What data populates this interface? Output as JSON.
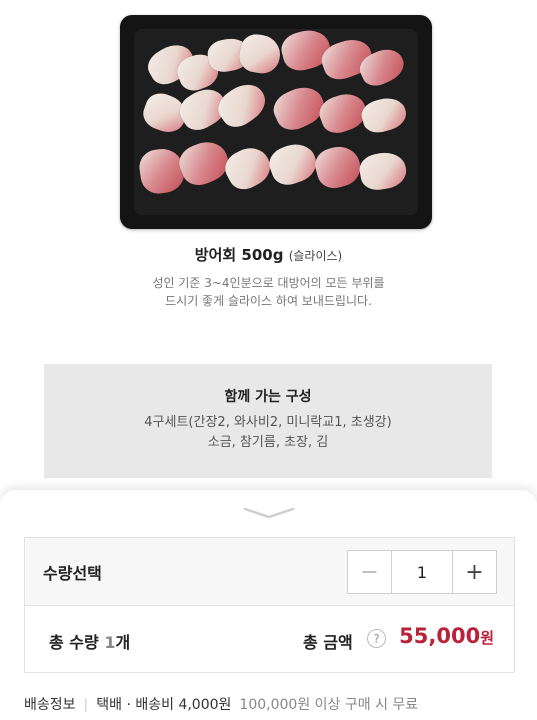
{
  "product": {
    "name": "방어회 500g",
    "name_suffix": "(슬라이스)",
    "desc_line1": "성인 기준 3~4인분으로 대방어의 모든 부위를",
    "desc_line2": "드시기 좋게 슬라이스 하여 보내드립니다."
  },
  "composition": {
    "title": "함께 가는 구성",
    "line1": "4구세트(간장2, 와사비2, 미니락교1, 초생강)",
    "line2": "소금, 참기름, 초장, 김"
  },
  "order": {
    "qty_label": "수량선택",
    "minus_symbol": "−",
    "qty_value": "1",
    "plus_symbol": "+",
    "total_qty_prefix": "총 수량 ",
    "total_qty_num": "1",
    "total_qty_suffix": "개",
    "total_amount_label": "총 금액",
    "help_symbol": "?",
    "price": "55,000",
    "price_unit": "원",
    "price_color": "#b8223a"
  },
  "shipping": {
    "label": "배송정보",
    "method": "택배 · 배송비 4,000원",
    "free_condition": "100,000원 이상 구매 시 무료"
  }
}
